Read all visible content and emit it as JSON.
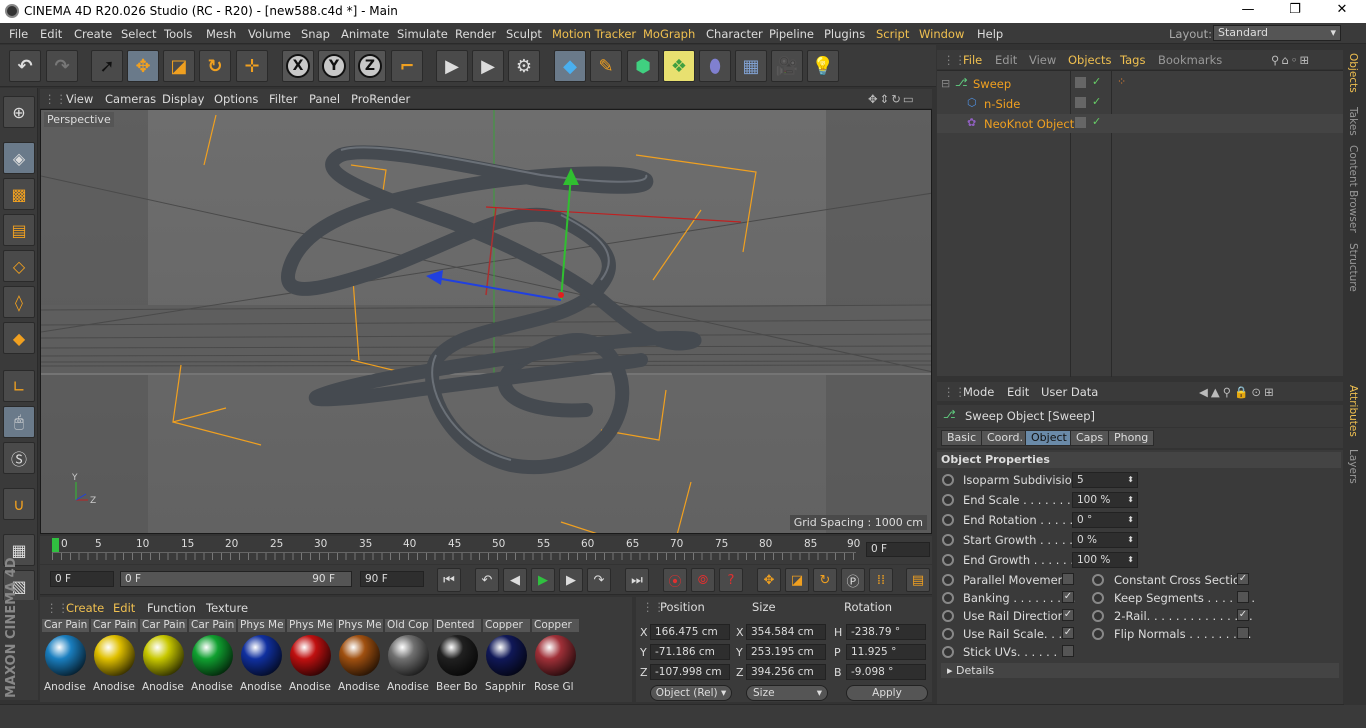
{
  "window": {
    "title": "CINEMA 4D R20.026 Studio (RC - R20) - [new588.c4d *] - Main",
    "minimize": "—",
    "maximize": "❐",
    "close": "✕"
  },
  "menu": [
    "File",
    "Edit",
    "Create",
    "Select",
    "Tools",
    "Mesh",
    "Volume",
    "Snap",
    "Animate",
    "Simulate",
    "Render",
    "Sculpt",
    "Motion Tracker",
    "MoGraph",
    "Character",
    "Pipeline",
    "Plugins",
    "Script",
    "Window",
    "Help"
  ],
  "layout": {
    "label": "Layout:",
    "value": "Standard"
  },
  "viewport": {
    "menu": [
      "View",
      "Cameras",
      "Display",
      "Options",
      "Filter",
      "Panel",
      "ProRender"
    ],
    "camera_label": "Perspective",
    "grid_spacing": "Grid Spacing : 1000 cm"
  },
  "timeline": {
    "ticks": [
      "0",
      "5",
      "10",
      "15",
      "20",
      "25",
      "30",
      "35",
      "40",
      "45",
      "50",
      "55",
      "60",
      "65",
      "70",
      "75",
      "80",
      "85",
      "90"
    ],
    "current_frame": "0 F",
    "start": "0 F",
    "range_start": "0 F",
    "range_end": "90 F",
    "end": "90 F"
  },
  "material_manager": {
    "menu": [
      "Create",
      "Edit",
      "Function",
      "Texture"
    ],
    "materials": [
      {
        "name": "Car Pain",
        "label": "Anodise",
        "color": "#1a7fc0"
      },
      {
        "name": "Car Pain",
        "label": "Anodise",
        "color": "#e0c000"
      },
      {
        "name": "Car Pain",
        "label": "Anodise",
        "color": "#c8c800"
      },
      {
        "name": "Car Pain",
        "label": "Anodise",
        "color": "#10a030"
      },
      {
        "name": "Phys Me",
        "label": "Anodise",
        "color": "#1030a0"
      },
      {
        "name": "Phys Me",
        "label": "Anodise",
        "color": "#c01010"
      },
      {
        "name": "Phys Me",
        "label": "Anodise",
        "color": "#a05010"
      },
      {
        "name": "Old Cop",
        "label": "Anodise",
        "color": "#707070"
      },
      {
        "name": "Dented",
        "label": "Beer Bo",
        "color": "#202020"
      },
      {
        "name": "Copper",
        "label": "Sapphir",
        "color": "#101858"
      },
      {
        "name": "Copper",
        "label": "Rose Gl",
        "color": "#a03038"
      }
    ]
  },
  "coordinates": {
    "headers": [
      "Position",
      "Size",
      "Rotation"
    ],
    "rows": [
      {
        "axis": "X",
        "pos": "166.475 cm",
        "saxis": "X",
        "size": "354.584 cm",
        "raxis": "H",
        "rot": "-238.79 °"
      },
      {
        "axis": "Y",
        "pos": "-71.186 cm",
        "saxis": "Y",
        "size": "253.195 cm",
        "raxis": "P",
        "rot": "11.925 °"
      },
      {
        "axis": "Z",
        "pos": "-107.998 cm",
        "saxis": "Z",
        "size": "394.256 cm",
        "raxis": "B",
        "rot": "-9.098 °"
      }
    ],
    "mode": "Object (Rel)",
    "size_mode": "Size",
    "apply": "Apply"
  },
  "object_manager": {
    "menu": [
      "File",
      "Edit",
      "View",
      "Objects",
      "Tags",
      "Bookmarks"
    ],
    "objects": [
      {
        "name": "Sweep",
        "icon": "sweep-icon"
      },
      {
        "name": "n-Side",
        "icon": "nside-icon"
      },
      {
        "name": "NeoKnot Object",
        "icon": "neoknot-icon"
      }
    ]
  },
  "side_tabs": [
    "Objects",
    "Takes",
    "Content Browser",
    "Structure"
  ],
  "side_tabs_lower": [
    "Attributes",
    "Layers"
  ],
  "attributes": {
    "menu": [
      "Mode",
      "Edit",
      "User Data"
    ],
    "title": "Sweep Object [Sweep]",
    "tabs": [
      "Basic",
      "Coord.",
      "Object",
      "Caps",
      "Phong"
    ],
    "section": "Object Properties",
    "fields": [
      {
        "label": "Isoparm Subdivision",
        "value": "5"
      },
      {
        "label": "End Scale . . . . . . . . . .",
        "value": "100 %"
      },
      {
        "label": "End Rotation . . . . . . .",
        "value": "0 °"
      },
      {
        "label": "Start Growth . . . . . . .",
        "value": "0 %"
      },
      {
        "label": "End Growth . . . . . . . .",
        "value": "100 %"
      }
    ],
    "checks_left": [
      {
        "label": "Parallel Movement",
        "checked": false
      },
      {
        "label": "Banking . . . . . . . . .",
        "checked": true
      },
      {
        "label": "Use Rail Direction",
        "checked": true
      },
      {
        "label": "Use Rail Scale. . . .",
        "checked": true
      },
      {
        "label": "Stick UVs. . . . . . . .",
        "checked": false
      }
    ],
    "checks_right": [
      {
        "label": "Constant Cross Section",
        "checked": true
      },
      {
        "label": "Keep Segments . . . . . . .",
        "checked": false
      },
      {
        "label": "2-Rail. . . . . . . . . . . . . . .",
        "checked": true
      },
      {
        "label": "Flip Normals . . . . . . . . .",
        "checked": false
      }
    ],
    "details": "Details"
  },
  "brand": "MAXON CINEMA 4D"
}
